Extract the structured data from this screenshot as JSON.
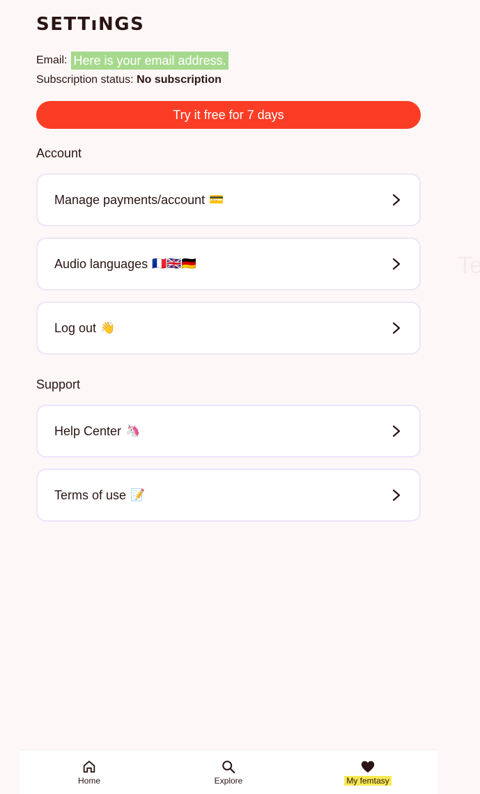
{
  "header": {
    "title": "SETTıNGS",
    "email_label": "Email:",
    "email_value": "Here is your email address.",
    "subscription_label": "Subscription status:",
    "subscription_value": "No subscription"
  },
  "cta": {
    "label": "Try it free for 7 days",
    "color": "#fc3d26"
  },
  "sections": {
    "account": {
      "title": "Account",
      "items": [
        {
          "label": "Manage payments/account",
          "emoji": "💳"
        },
        {
          "label": "Audio languages",
          "emoji": "🇫🇷🇬🇧🇩🇪"
        },
        {
          "label": "Log out",
          "emoji": "👋"
        }
      ]
    },
    "support": {
      "title": "Support",
      "items": [
        {
          "label": "Help Center",
          "emoji": "🦄"
        },
        {
          "label": "Terms of use",
          "emoji": "📝"
        }
      ]
    }
  },
  "ghost_text": "Te",
  "bottom_nav": {
    "items": [
      {
        "label": "Home",
        "icon": "home-icon"
      },
      {
        "label": "Explore",
        "icon": "search-icon"
      },
      {
        "label": "My femtasy",
        "icon": "heart-icon",
        "active": true
      }
    ],
    "active_highlight": "#f7ea52"
  }
}
